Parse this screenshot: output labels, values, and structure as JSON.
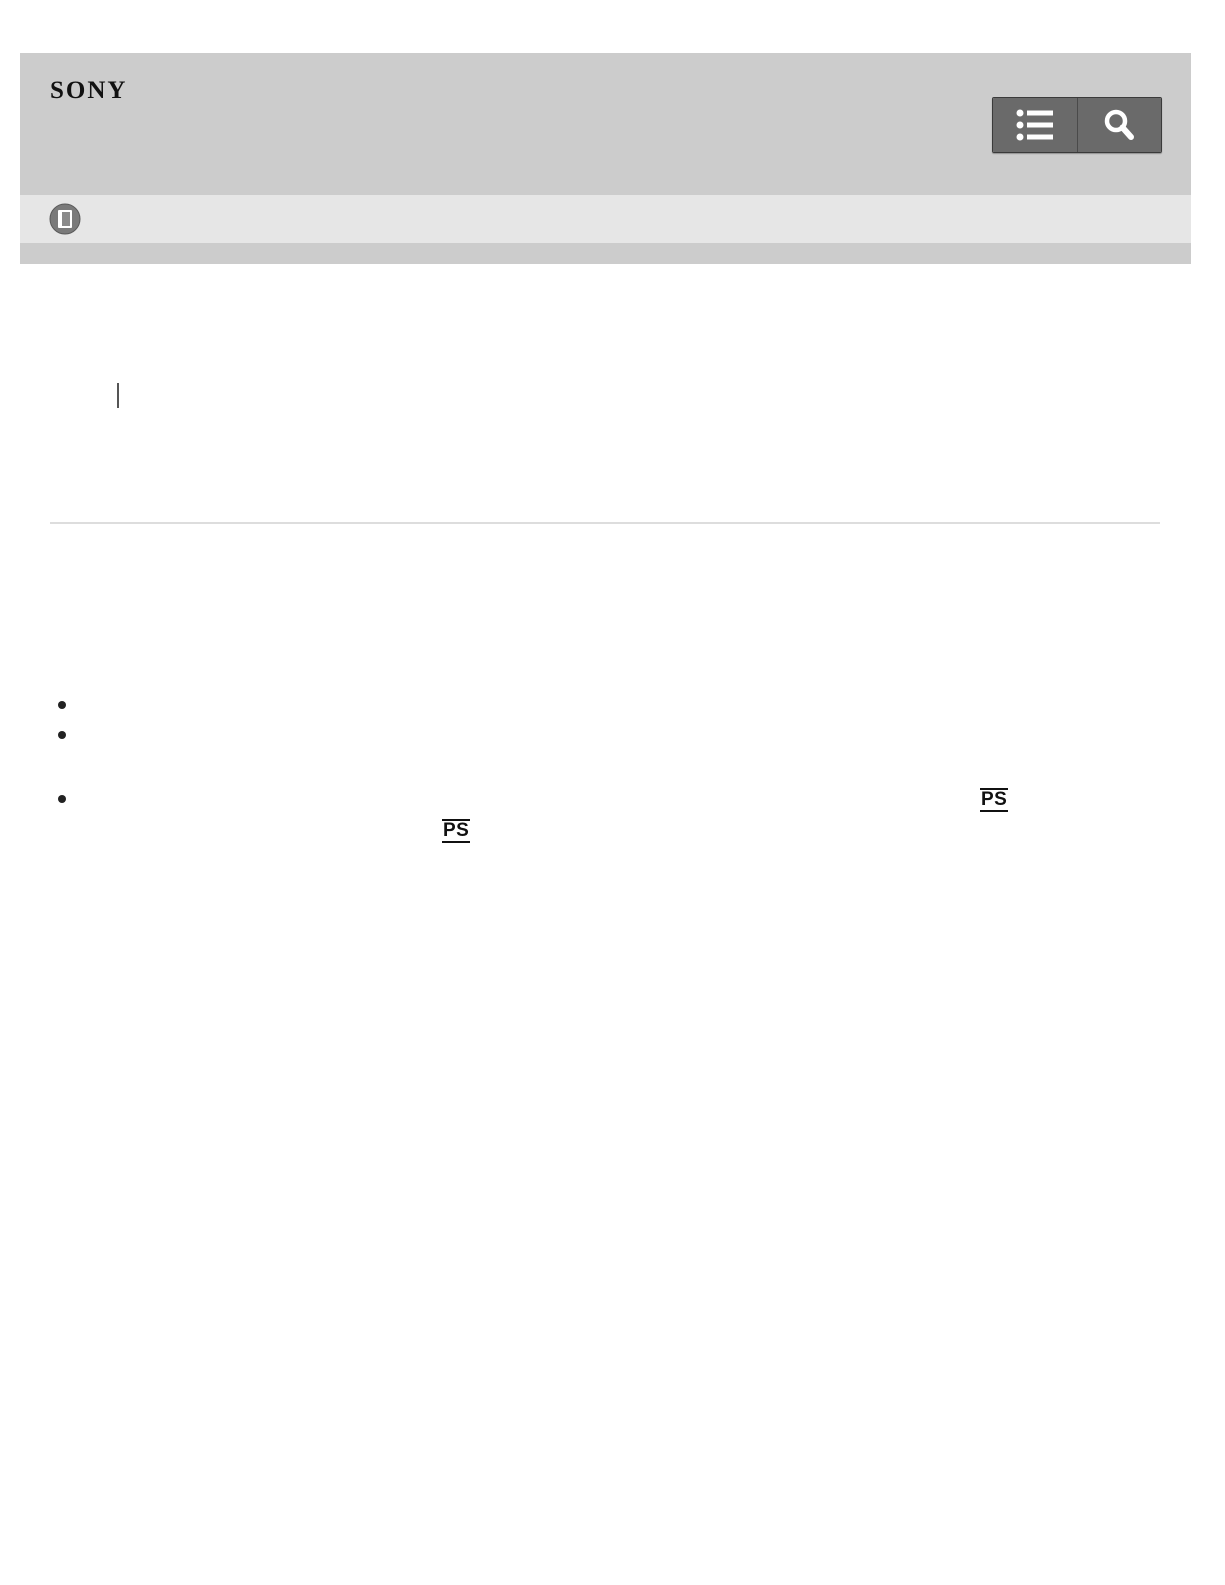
{
  "header": {
    "logo": "SONY",
    "menu_icon": "list-icon",
    "search_icon": "search-icon"
  },
  "subbar": {
    "icon": "help-guide-book-icon"
  },
  "breadcrumb": {
    "left": "",
    "right": ""
  },
  "content": {
    "bullets": [
      "",
      "",
      ""
    ],
    "ps_marks": [
      "PS",
      "PS"
    ]
  },
  "colors": {
    "header_bg": "#cccccc",
    "subbar_bg": "#e6e6e6",
    "button_bg": "#6a6a6a"
  }
}
